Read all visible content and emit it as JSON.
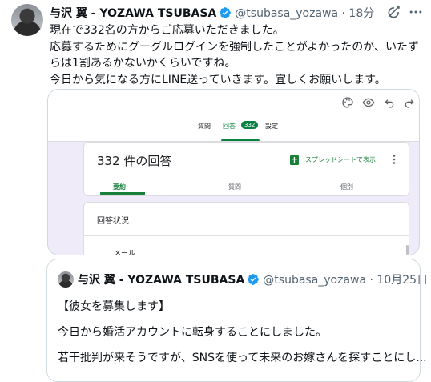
{
  "tweet": {
    "author_name": "与沢 翼 - YOZAWA TSUBASA",
    "handle_time": "@tsubasa_yozawa · 18分",
    "text": "現在で332名の方からご応募いただきました。\n応募するためにグーグルログインを強制したことがよかったのか、いたずらは1割あるかないかくらいですね。\n今日から気になる方にLINE送っていきます。宜しくお願いします。"
  },
  "embedded_form": {
    "tabs": [
      "質問",
      "回答",
      "設定"
    ],
    "response_badge": "332",
    "responses_title": "332 件の回答",
    "sheets_label": "スプレッドシートで表示",
    "sub_tabs": [
      "要約",
      "質問",
      "個別"
    ],
    "status_title": "回答状況",
    "email_label": "メール"
  },
  "quoted_tweet": {
    "author_name": "与沢 翼 - YOZAWA TSUBASA",
    "handle_date": "@tsubasa_yozawa · 10月25日",
    "line1": "【彼女を募集します】",
    "line2": "今日から婚活アカウントに転身することにしました。",
    "line3": "若干批判が来そうですが、SNSを使って未来のお嫁さんを探すことにし..."
  },
  "colors": {
    "verified": "#1d9bf0",
    "forms_green": "#188038",
    "text_secondary": "#536471",
    "border": "#cfd9de"
  },
  "icons": [
    "verified-badge-icon",
    "grok-icon",
    "more-icon",
    "palette-icon",
    "preview-icon",
    "undo-icon",
    "redo-icon",
    "sheets-icon"
  ]
}
